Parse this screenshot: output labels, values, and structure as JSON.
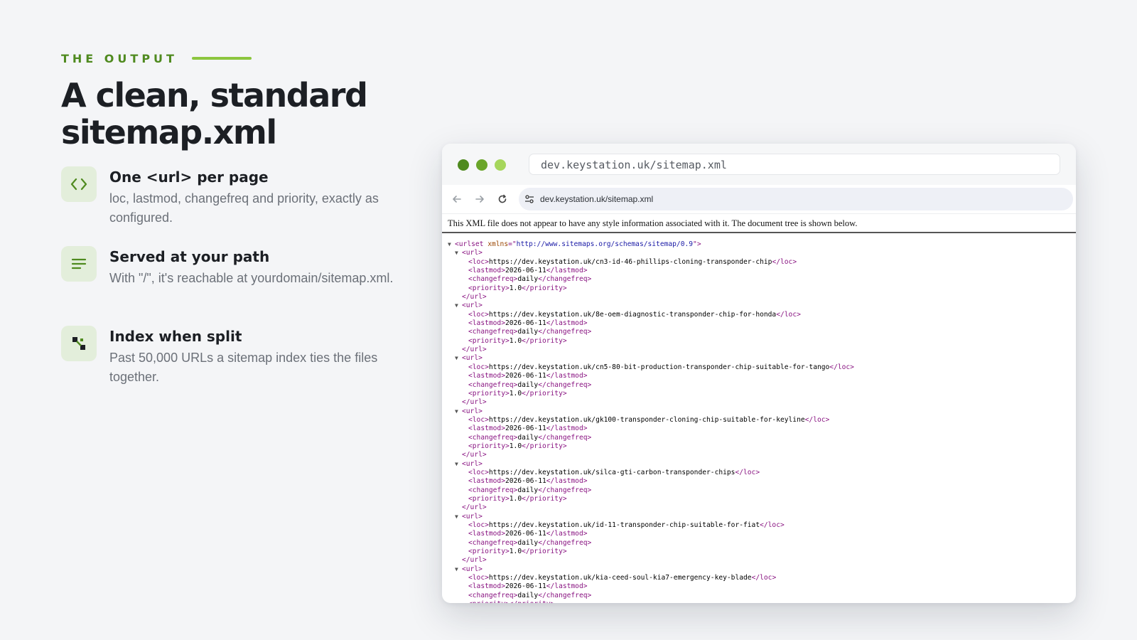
{
  "left": {
    "eyebrow": "THE OUTPUT",
    "title_line1": "A clean, standard",
    "title_line2": "sitemap.xml",
    "features": [
      {
        "icon": "code-brackets-icon",
        "title": "One <url> per page",
        "desc": "loc, lastmod, changefreq and priority, exactly as configured."
      },
      {
        "icon": "lines-icon",
        "title": "Served at your path",
        "desc": "With \"/\", it's reachable at yourdomain/sitemap.xml."
      },
      {
        "icon": "nodes-icon",
        "title": "Index when split",
        "desc": "Past 50,000 URLs a sitemap index ties the files together."
      }
    ]
  },
  "browser": {
    "address_bar": "dev.keystation.uk/sitemap.xml",
    "omnibox": "dev.keystation.uk/sitemap.xml",
    "notice": "This XML file does not appear to have any style information associated with it. The document tree is shown below.",
    "xmlns": "http://www.sitemaps.org/schemas/sitemap/0.9",
    "urls": [
      {
        "loc": "https://dev.keystation.uk/cn3-id-46-phillips-cloning-transponder-chip",
        "lastmod": "2026-06-11",
        "changefreq": "daily",
        "priority": "1.0"
      },
      {
        "loc": "https://dev.keystation.uk/8e-oem-diagnostic-transponder-chip-for-honda",
        "lastmod": "2026-06-11",
        "changefreq": "daily",
        "priority": "1.0"
      },
      {
        "loc": "https://dev.keystation.uk/cn5-80-bit-production-transponder-chip-suitable-for-tango",
        "lastmod": "2026-06-11",
        "changefreq": "daily",
        "priority": "1.0"
      },
      {
        "loc": "https://dev.keystation.uk/gk100-transponder-cloning-chip-suitable-for-keyline",
        "lastmod": "2026-06-11",
        "changefreq": "daily",
        "priority": "1.0"
      },
      {
        "loc": "https://dev.keystation.uk/silca-gti-carbon-transponder-chips",
        "lastmod": "2026-06-11",
        "changefreq": "daily",
        "priority": "1.0"
      },
      {
        "loc": "https://dev.keystation.uk/id-11-transponder-chip-suitable-for-fiat",
        "lastmod": "2026-06-11",
        "changefreq": "daily",
        "priority": "1.0"
      },
      {
        "loc": "https://dev.keystation.uk/kia-ceed-soul-kia7-emergency-key-blade",
        "lastmod": "2026-06-11",
        "changefreq": "daily",
        "priority": ""
      }
    ],
    "colors": {
      "accent": "#4f8a1f",
      "accent_light": "#8cc63f",
      "icon_bg": "#e3eedb"
    }
  }
}
